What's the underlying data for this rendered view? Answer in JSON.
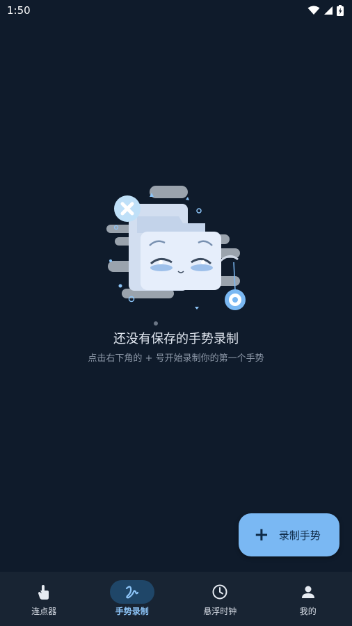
{
  "status": {
    "time": "1:50",
    "icons": [
      "wifi-icon",
      "signal-icon",
      "battery-icon"
    ]
  },
  "empty_state": {
    "title": "还没有保存的手势录制",
    "subtitle": "点击右下角的 + 号开始录制你的第一个手势"
  },
  "fab": {
    "icon": "plus-icon",
    "label": "录制手势"
  },
  "nav": {
    "items": [
      {
        "label": "连点器",
        "icon": "tap-hand-icon"
      },
      {
        "label": "手势录制",
        "icon": "gesture-icon"
      },
      {
        "label": "悬浮时钟",
        "icon": "clock-icon"
      },
      {
        "label": "我的",
        "icon": "person-icon"
      }
    ],
    "active_index": 1
  },
  "colors": {
    "background": "#0f1b2b",
    "nav_background": "#182433",
    "accent": "#7ab8f3",
    "active_indicator": "#1f4668"
  }
}
